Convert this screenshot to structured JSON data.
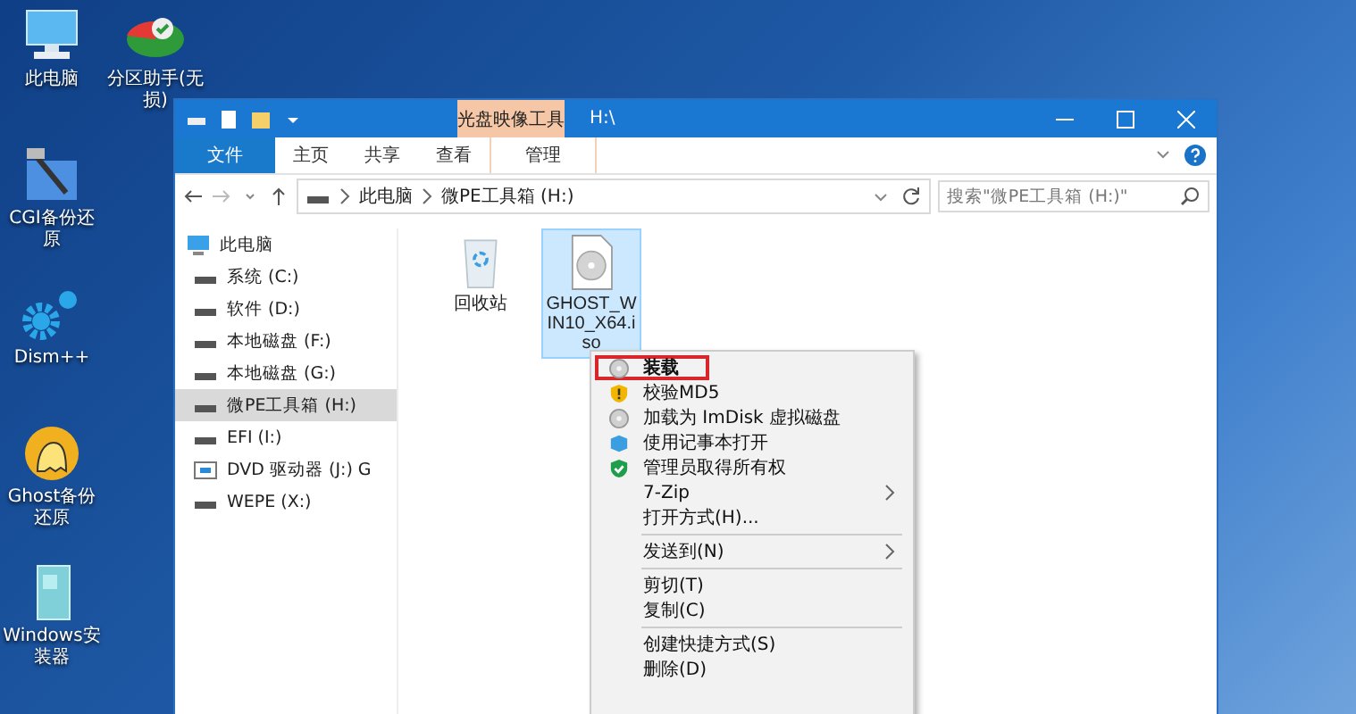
{
  "desktop": {
    "columns": [
      [
        {
          "label": "此电脑",
          "kind": "computer"
        },
        {
          "label": "CGI备份还原",
          "kind": "tool"
        },
        {
          "label": "Dism++",
          "kind": "gears"
        },
        {
          "label": "Ghost备份还原",
          "kind": "ghost"
        },
        {
          "label": "Windows安装器",
          "kind": "installer"
        }
      ],
      [
        {
          "label": "分区助手(无损)",
          "kind": "partition"
        }
      ]
    ]
  },
  "window": {
    "contextual_tab": "光盘映像工具",
    "title": "H:\\",
    "tabs": [
      {
        "label": "文件",
        "kind": "file",
        "selected": false
      },
      {
        "label": "主页",
        "kind": "normal",
        "selected": false
      },
      {
        "label": "共享",
        "kind": "normal",
        "selected": false
      },
      {
        "label": "查看",
        "kind": "normal",
        "selected": false
      },
      {
        "label": "管理",
        "kind": "contextual",
        "selected": false
      }
    ],
    "address": {
      "crumbs": [
        "此电脑",
        "微PE工具箱 (H:)"
      ]
    },
    "search": {
      "placeholder": "搜索\"微PE工具箱 (H:)\""
    },
    "nav": [
      {
        "label": "此电脑",
        "kind": "computer",
        "selected": false,
        "children": [
          {
            "label": "系统 (C:)",
            "kind": "drive",
            "selected": false
          },
          {
            "label": "软件 (D:)",
            "kind": "drive",
            "selected": false
          },
          {
            "label": "本地磁盘 (F:)",
            "kind": "drive",
            "selected": false
          },
          {
            "label": "本地磁盘 (G:)",
            "kind": "drive",
            "selected": false
          },
          {
            "label": "微PE工具箱 (H:)",
            "kind": "drive",
            "selected": true
          },
          {
            "label": "EFI (I:)",
            "kind": "drive",
            "selected": false
          },
          {
            "label": "DVD 驱动器 (J:) G",
            "kind": "dvd",
            "selected": false
          },
          {
            "label": "WEPE (X:)",
            "kind": "drive",
            "selected": false
          }
        ]
      }
    ],
    "files": [
      {
        "name": "回收站",
        "kind": "recycle",
        "selected": false
      },
      {
        "name": "GHOST_WIN10_X64.iso",
        "kind": "disc",
        "selected": true
      }
    ]
  },
  "context_menu": [
    {
      "kind": "disc",
      "label": "装载",
      "default": true,
      "outlined": true,
      "submenu": false
    },
    {
      "kind": "warning-shield",
      "label": "校验MD5",
      "default": false,
      "outlined": false,
      "submenu": false
    },
    {
      "kind": "disc",
      "label": "加载为 ImDisk 虚拟磁盘",
      "default": false,
      "outlined": false,
      "submenu": false
    },
    {
      "kind": "cube",
      "label": "使用记事本打开",
      "default": false,
      "outlined": false,
      "submenu": false
    },
    {
      "kind": "check-shield",
      "label": "管理员取得所有权",
      "default": false,
      "outlined": false,
      "submenu": false
    },
    {
      "kind": "plain",
      "label": "7-Zip",
      "default": false,
      "outlined": false,
      "submenu": true
    },
    {
      "kind": "plain",
      "label": "打开方式(H)...",
      "default": false,
      "outlined": false,
      "submenu": false
    },
    {
      "kind": "separator"
    },
    {
      "kind": "plain",
      "label": "发送到(N)",
      "default": false,
      "outlined": false,
      "submenu": true
    },
    {
      "kind": "separator"
    },
    {
      "kind": "plain",
      "label": "剪切(T)",
      "default": false,
      "outlined": false,
      "submenu": false
    },
    {
      "kind": "plain",
      "label": "复制(C)",
      "default": false,
      "outlined": false,
      "submenu": false
    },
    {
      "kind": "separator"
    },
    {
      "kind": "plain",
      "label": "创建快捷方式(S)",
      "default": false,
      "outlined": false,
      "submenu": false
    },
    {
      "kind": "plain",
      "label": "删除(D)",
      "default": false,
      "outlined": false,
      "submenu": false
    }
  ]
}
